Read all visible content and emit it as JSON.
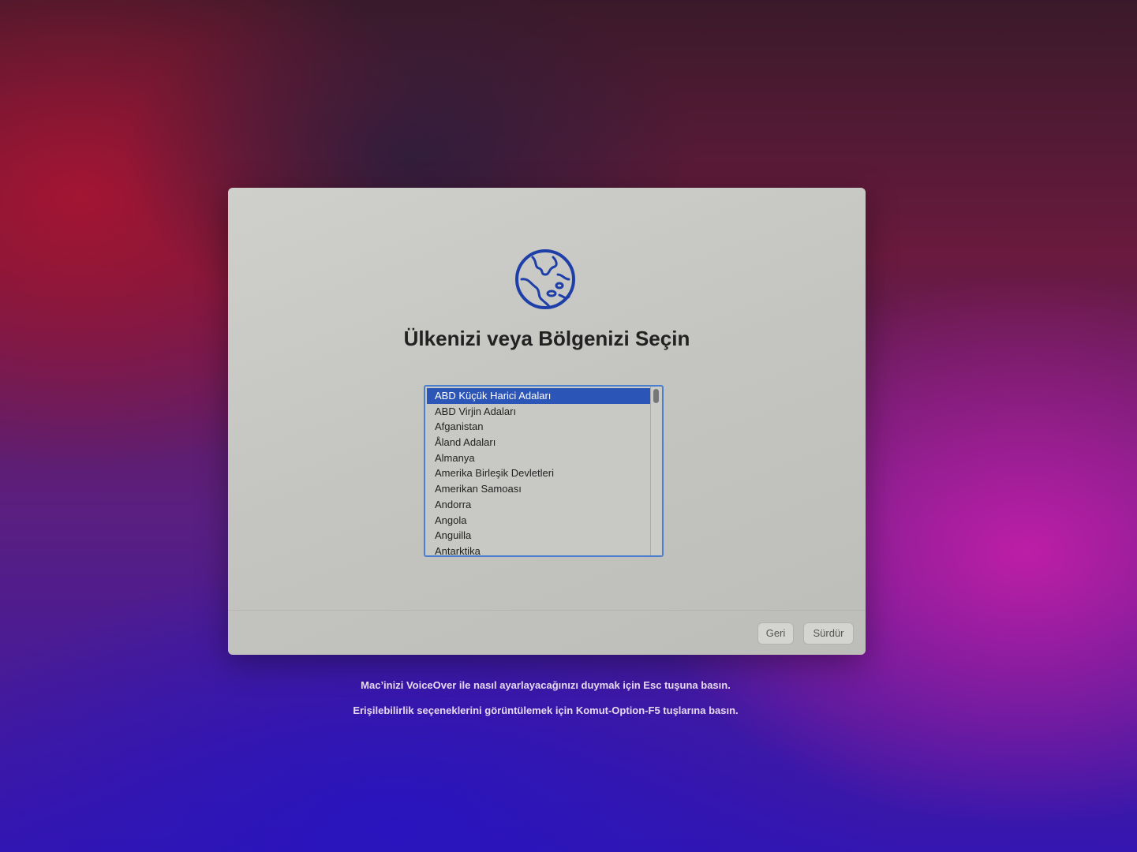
{
  "dialog": {
    "title": "Ülkenizi veya Bölgenizi Seçin",
    "icon": "globe-icon",
    "countries": [
      "ABD Küçük Harici Adaları",
      "ABD Virjin Adaları",
      "Afganistan",
      "Åland Adaları",
      "Almanya",
      "Amerika Birleşik Devletleri",
      "Amerikan Samoası",
      "Andorra",
      "Angola",
      "Anguilla",
      "Antarktika"
    ],
    "selected_index": 0,
    "back_label": "Geri",
    "continue_label": "Sürdür"
  },
  "hints": {
    "voiceover": "Mac’inizi VoiceOver ile nasıl ayarlayacağınızı duymak için Esc tuşuna basın.",
    "accessibility": "Erişilebilirlik seçeneklerini görüntülemek için Komut-Option-F5 tuşlarına basın."
  },
  "colors": {
    "accent": "#2c55b8",
    "globe_stroke": "#1f3fa8",
    "list_border": "#4a7fd0"
  }
}
